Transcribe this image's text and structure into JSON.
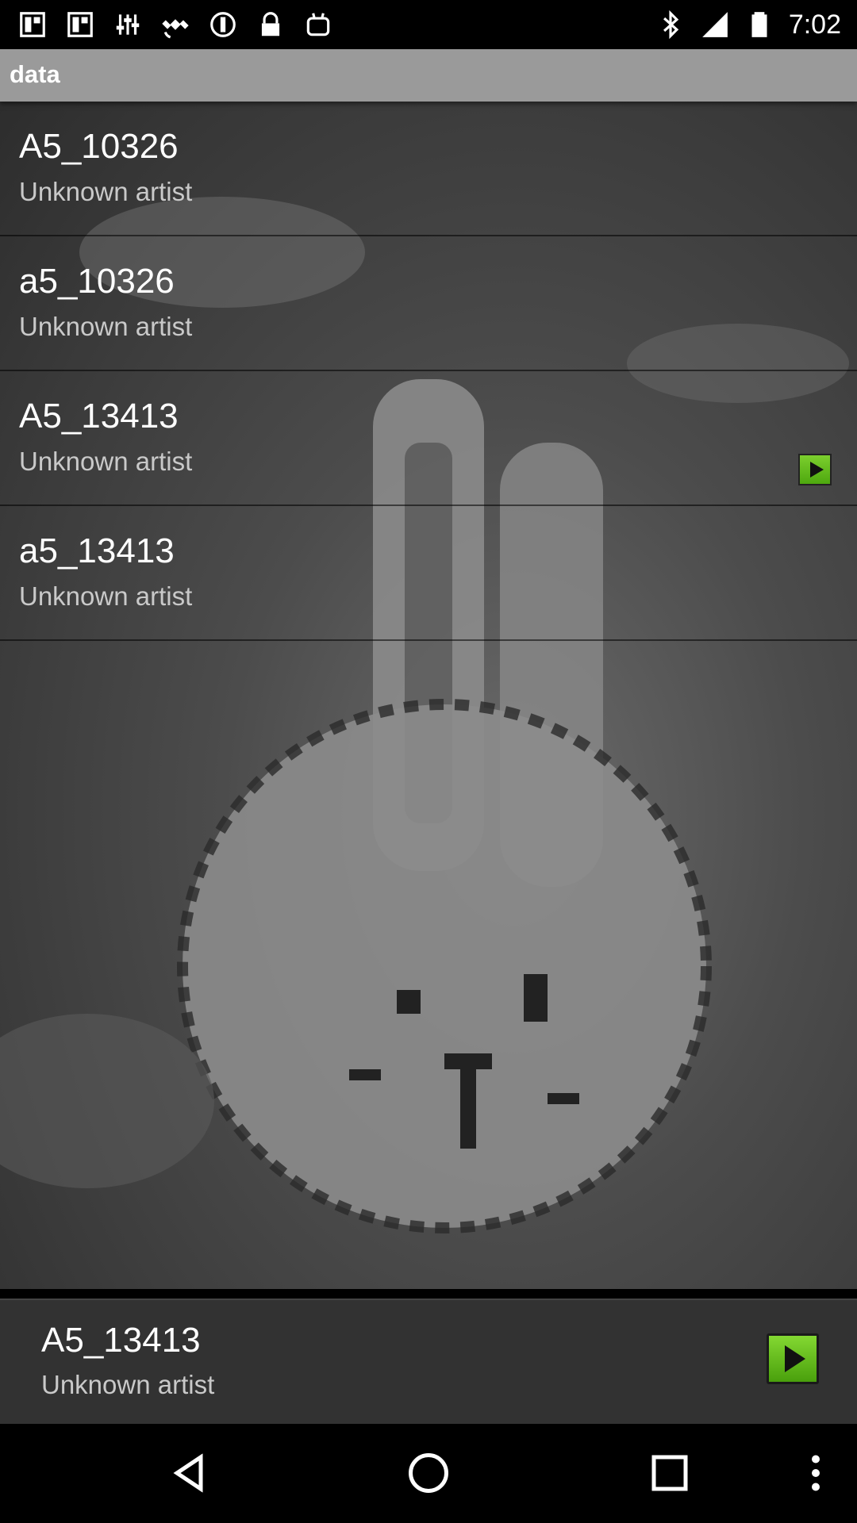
{
  "status_bar": {
    "time": "7:02",
    "icons": [
      "photo-icon",
      "photo-icon",
      "equalizer-icon",
      "satellite-icon",
      "circle-icon",
      "lock-icon",
      "android-icon",
      "bluetooth-icon",
      "signal-icon",
      "battery-icon"
    ]
  },
  "header": {
    "title": "data"
  },
  "songs": [
    {
      "title": "A5_10326",
      "artist": "Unknown artist"
    },
    {
      "title": "a5_10326",
      "artist": "Unknown artist"
    },
    {
      "title": "A5_13413",
      "artist": "Unknown artist",
      "playing": true
    },
    {
      "title": "a5_13413",
      "artist": "Unknown artist"
    }
  ],
  "now_playing": {
    "title": "A5_13413",
    "artist": "Unknown artist"
  },
  "nav": [
    "back-icon",
    "home-icon",
    "recents-icon",
    "menu-icon"
  ],
  "colors": {
    "title_bar": "#9a9a9a",
    "play_green": "#5cb81a",
    "now_playing_bg": "#323232"
  }
}
